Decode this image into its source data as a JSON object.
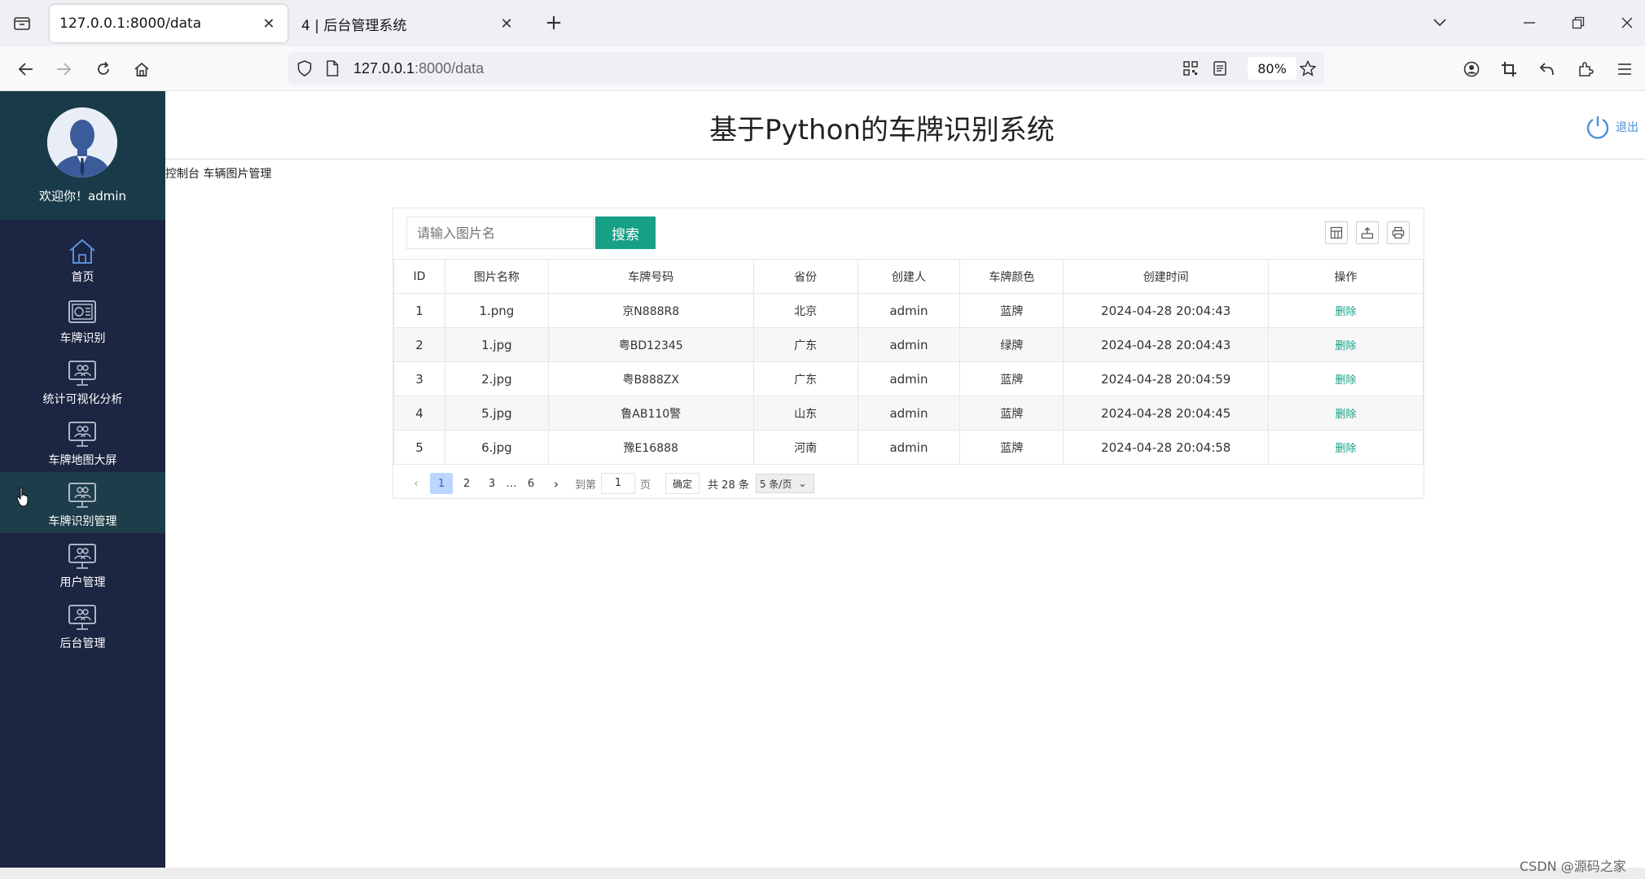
{
  "browser": {
    "tabs": [
      {
        "title": "127.0.0.1:8000/data",
        "active": true
      },
      {
        "title": "4 | 后台管理系统",
        "active": false
      }
    ],
    "url_host": "127.0.0.1",
    "url_rest": ":8000/data",
    "zoom": "80%"
  },
  "sidebar": {
    "welcome": "欢迎你！admin",
    "items": [
      {
        "label": "首页",
        "icon": "home-icon"
      },
      {
        "label": "车牌识别",
        "icon": "dashboard-icon"
      },
      {
        "label": "统计可视化分析",
        "icon": "monitor-user-icon"
      },
      {
        "label": "车牌地图大屏",
        "icon": "monitor-user-icon"
      },
      {
        "label": "车牌识别管理",
        "icon": "monitor-user-icon"
      },
      {
        "label": "用户管理",
        "icon": "monitor-user-icon"
      },
      {
        "label": "后台管理",
        "icon": "monitor-user-icon"
      }
    ]
  },
  "header": {
    "title": "基于Python的车牌识别系统",
    "logout": "退出"
  },
  "breadcrumb": "控制台 车辆图片管理",
  "search": {
    "placeholder": "请输入图片名",
    "button": "搜索"
  },
  "table": {
    "columns": [
      "ID",
      "图片名称",
      "车牌号码",
      "省份",
      "创建人",
      "车牌颜色",
      "创建时间",
      "操作"
    ],
    "rows": [
      {
        "id": "1",
        "name": "1.png",
        "plate": "京N888R8",
        "province": "北京",
        "creator": "admin",
        "color": "蓝牌",
        "time": "2024-04-28 20:04:43",
        "op": "删除"
      },
      {
        "id": "2",
        "name": "1.jpg",
        "plate": "粤BD12345",
        "province": "广东",
        "creator": "admin",
        "color": "绿牌",
        "time": "2024-04-28 20:04:43",
        "op": "删除"
      },
      {
        "id": "3",
        "name": "2.jpg",
        "plate": "粤B888ZX",
        "province": "广东",
        "creator": "admin",
        "color": "蓝牌",
        "time": "2024-04-28 20:04:59",
        "op": "删除"
      },
      {
        "id": "4",
        "name": "5.jpg",
        "plate": "鲁AB110警",
        "province": "山东",
        "creator": "admin",
        "color": "蓝牌",
        "time": "2024-04-28 20:04:45",
        "op": "删除"
      },
      {
        "id": "5",
        "name": "6.jpg",
        "plate": "豫E16888",
        "province": "河南",
        "creator": "admin",
        "color": "蓝牌",
        "time": "2024-04-28 20:04:58",
        "op": "删除"
      }
    ]
  },
  "pager": {
    "pages": [
      "1",
      "2",
      "3"
    ],
    "ellipsis": "…",
    "last": "6",
    "goto_label": "到第",
    "goto_value": "1",
    "page_unit": "页",
    "confirm": "确定",
    "total": "共 28 条",
    "page_size": "5 条/页"
  },
  "watermark": "CSDN @源码之家",
  "colors": {
    "sidebar_bg": "#1c2541",
    "sidebar_top_bg": "#193b49",
    "accent": "#16a085"
  }
}
